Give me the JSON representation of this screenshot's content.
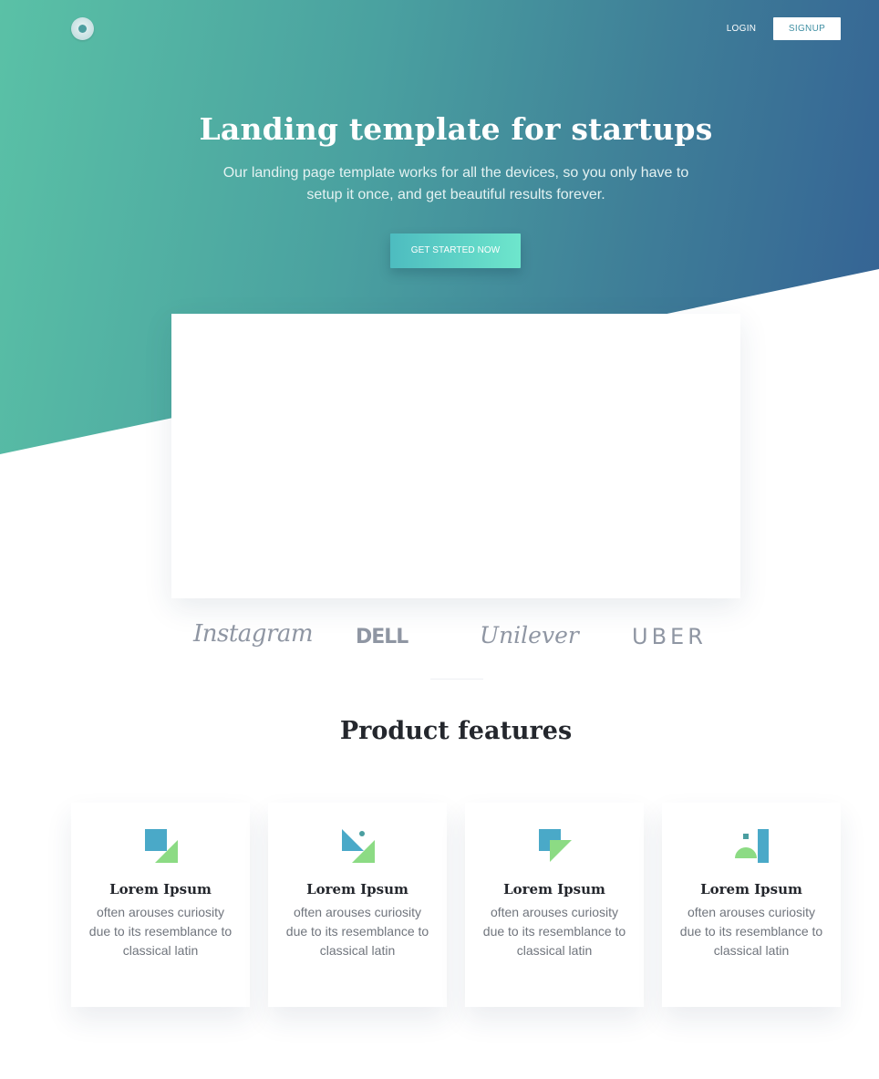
{
  "header": {
    "logo_icon": "circle-ring-logo",
    "login_label": "LOGIN",
    "signup_label": "SIGNUP"
  },
  "hero": {
    "title": "Landing template for startups",
    "subtitle": "Our landing page template works for all the devices, so you only have to setup it once, and get beautiful results forever.",
    "cta_label": "GET STARTED NOW",
    "gradient_colors": [
      "#5ac1a6",
      "#346194"
    ],
    "cta_gradient": [
      "#4dbcc0",
      "#6ee6cc"
    ]
  },
  "clients": {
    "logos": [
      "Instagram",
      "DELL",
      "Unilever",
      "UBER"
    ]
  },
  "features": {
    "title": "Product features",
    "items": [
      {
        "icon": "square-triangle-icon",
        "title": "Lorem Ipsum",
        "description": "often arouses curiosity due to its resemblance to classical latin"
      },
      {
        "icon": "triangles-dot-icon",
        "title": "Lorem Ipsum",
        "description": "often arouses curiosity due to its resemblance to classical latin"
      },
      {
        "icon": "square-overlap-triangle-icon",
        "title": "Lorem Ipsum",
        "description": "often arouses curiosity due to its resemblance to classical latin"
      },
      {
        "icon": "semicircle-bar-icon",
        "title": "Lorem Ipsum",
        "description": "often arouses curiosity due to its resemblance to classical latin"
      }
    ]
  },
  "colors": {
    "icon_blue": "#4aa9c8",
    "icon_green": "#8cdb84",
    "heading": "#24272d",
    "body_text": "#70757d",
    "logo_gray": "#8f96a3"
  }
}
